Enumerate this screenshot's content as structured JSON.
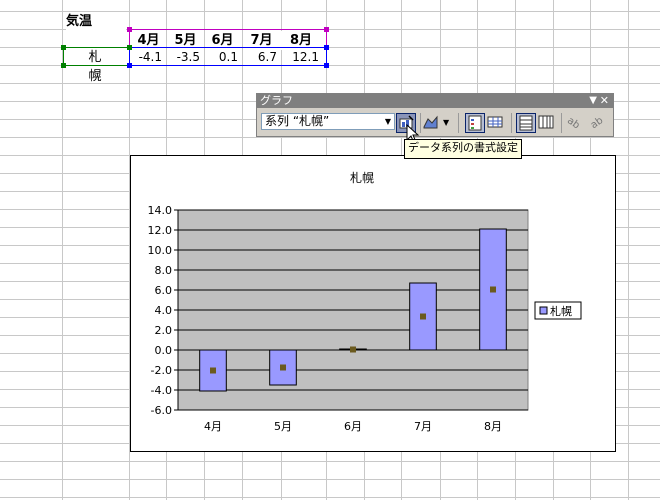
{
  "sheet": {
    "title": "気温",
    "months": [
      "4月",
      "5月",
      "6月",
      "7月",
      "8月"
    ],
    "row_label": "札 幌",
    "values": [
      "-4.1",
      "-3.5",
      "0.1",
      "6.7",
      "12.1"
    ]
  },
  "toolbar": {
    "title": "グラフ",
    "series_selector": "系列 “札幌”",
    "tooltip": "データ系列の書式設定",
    "buttons": [
      "format-data-series-icon",
      "chart-type-icon",
      "legend-icon",
      "data-table-icon",
      "by-row-icon",
      "by-column-icon",
      "angle-text-down-icon",
      "angle-text-up-icon"
    ]
  },
  "chart_data": {
    "type": "bar",
    "title": "札幌",
    "categories": [
      "4月",
      "5月",
      "6月",
      "7月",
      "8月"
    ],
    "series": [
      {
        "name": "札幌",
        "values": [
          -4.1,
          -3.5,
          0.1,
          6.7,
          12.1
        ]
      }
    ],
    "ylim": [
      -6.0,
      14.0
    ],
    "yticks": [
      "14.0",
      "12.0",
      "10.0",
      "8.0",
      "6.0",
      "4.0",
      "2.0",
      "0.0",
      "-2.0",
      "-4.0",
      "-6.0"
    ],
    "grid": true,
    "legend": "right",
    "plot_bg": "#c0c0c0",
    "bar_color": "#9999ff",
    "marker_color": "#6b5a1e"
  }
}
